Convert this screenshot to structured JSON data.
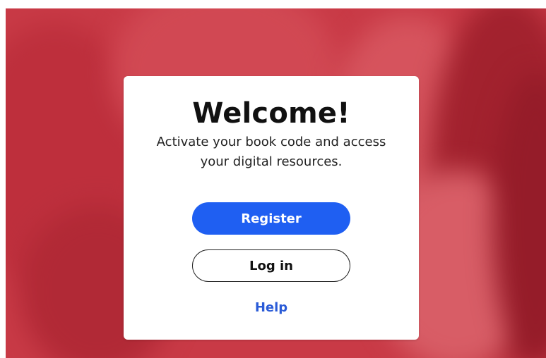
{
  "welcome": {
    "title": "Welcome!",
    "subtitle_line1": "Activate your book code and access",
    "subtitle_line2": "your digital resources.",
    "register_label": "Register",
    "login_label": "Log in",
    "help_label": "Help"
  },
  "colors": {
    "primary_button": "#1f5ff2",
    "help_link": "#2a5bd7",
    "background_tint": "#c9444f"
  }
}
